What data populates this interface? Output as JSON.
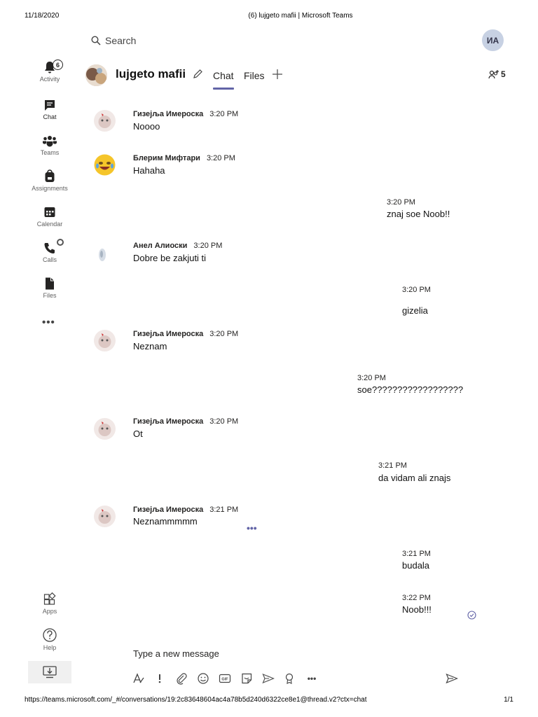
{
  "print": {
    "date": "11/18/2020",
    "title": "(6) lujgeto mafii | Microsoft Teams",
    "url": "https://teams.microsoft.com/_#/conversations/19:2c83648604ac4a78b5d240d6322ce8e1@thread.v2?ctx=chat",
    "page": "1/1"
  },
  "search": {
    "placeholder": "Search"
  },
  "user": {
    "initials": "ИА"
  },
  "rail": {
    "activity": {
      "label": "Activity",
      "badge": "6"
    },
    "chat": {
      "label": "Chat"
    },
    "teams": {
      "label": "Teams"
    },
    "assignments": {
      "label": "Assignments"
    },
    "calendar": {
      "label": "Calendar"
    },
    "calls": {
      "label": "Calls"
    },
    "files": {
      "label": "Files"
    },
    "more": "•••",
    "apps": {
      "label": "Apps"
    },
    "help": {
      "label": "Help"
    }
  },
  "chat": {
    "title": "lujgeto mafii",
    "tabs": {
      "chat": "Chat",
      "files": "Files"
    },
    "participant_count": "5"
  },
  "messages": [
    {
      "sender": "Гизејља Имероска",
      "time": "3:20 PM",
      "text": "Noooo"
    },
    {
      "sender": "Блерим Мифтари",
      "time": "3:20 PM",
      "text": "Hahaha"
    },
    {
      "own": true,
      "time": "3:20 PM",
      "text": "znaj soe Noob!!"
    },
    {
      "sender": "Анел Алиоски",
      "time": "3:20 PM",
      "text": "Dobre be zakjuti ti"
    },
    {
      "own": true,
      "time": "3:20 PM",
      "text": "gizelia"
    },
    {
      "sender": "Гизејља Имероска",
      "time": "3:20 PM",
      "text": "Neznam"
    },
    {
      "own": true,
      "time": "3:20 PM",
      "text": "soe??????????????????"
    },
    {
      "sender": "Гизејља Имероска",
      "time": "3:20 PM",
      "text": "Ot"
    },
    {
      "own": true,
      "time": "3:21 PM",
      "text": "da vidam ali znajs"
    },
    {
      "sender": "Гизејља Имероска",
      "time": "3:21 PM",
      "text": "Neznammmmm"
    },
    {
      "own": true,
      "time": "3:21 PM",
      "text": "budala"
    },
    {
      "own": true,
      "time": "3:22 PM",
      "text": "Noob!!!"
    }
  ],
  "hover_more": "•••",
  "composer": {
    "placeholder": "Type a new message"
  },
  "toolbar": {
    "icons": [
      "format-icon",
      "important-icon",
      "attach-icon",
      "emoji-icon",
      "gif-icon",
      "sticker-icon",
      "schedule-meeting-icon",
      "praise-icon",
      "more-options-icon",
      "send-icon"
    ],
    "gif_label": "GIF",
    "more": "•••"
  },
  "colors": {
    "accent": "#6264a7",
    "text": "#252423",
    "avatar_me": "#c7d1e3"
  }
}
